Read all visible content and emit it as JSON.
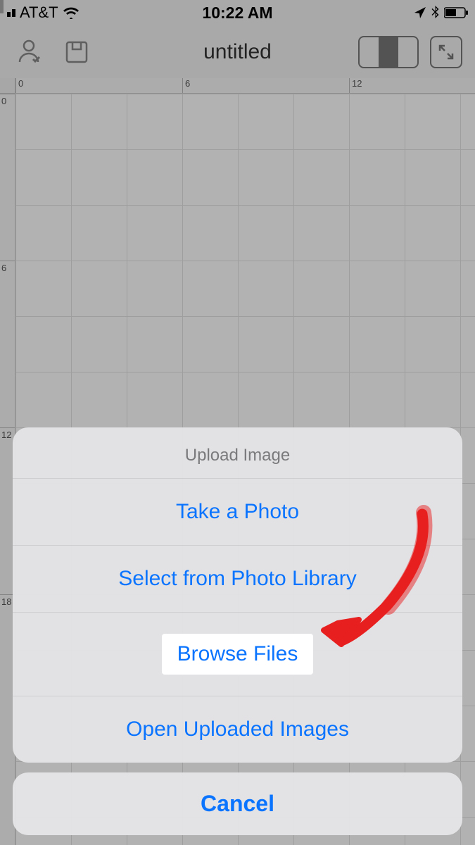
{
  "status": {
    "carrier": "AT&T",
    "time": "10:22 AM"
  },
  "toolbar": {
    "title": "untitled"
  },
  "ruler": {
    "hticks": [
      "0",
      "6",
      "12"
    ],
    "vticks": [
      "0",
      "6",
      "12",
      "18"
    ]
  },
  "sheet": {
    "title": "Upload Image",
    "options": {
      "take_photo": "Take a Photo",
      "select_library": "Select from Photo Library",
      "browse_files": "Browse Files",
      "open_uploaded": "Open Uploaded Images"
    },
    "cancel": "Cancel"
  }
}
